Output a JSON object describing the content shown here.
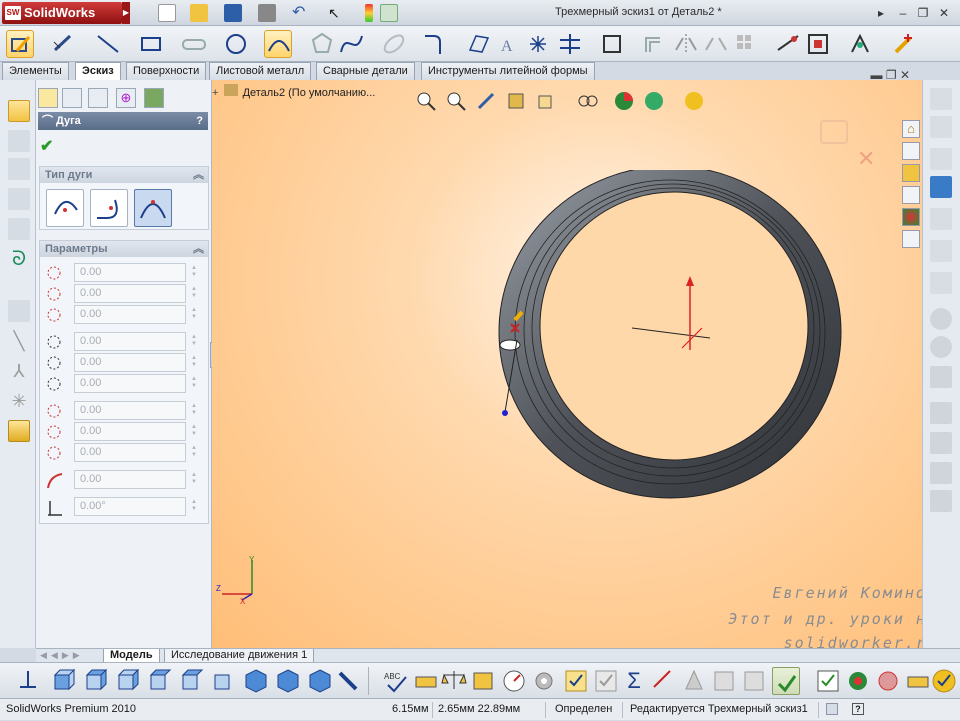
{
  "app": {
    "name": "SolidWorks",
    "window_title": "Трехмерный эскиз1 от Деталь2 *"
  },
  "command_tabs": [
    "Элементы",
    "Эскиз",
    "Поверхности",
    "Листовой металл",
    "Сварные детали",
    "Инструменты литейной формы"
  ],
  "active_tab": "Эскиз",
  "property_manager": {
    "title": "Дуга",
    "help": "?",
    "ok_symbol": "✔",
    "arc_type_group": "Тип дуги",
    "params_group": "Параметры",
    "params": [
      "0.00",
      "0.00",
      "0.00",
      "0.00",
      "0.00",
      "0.00",
      "0.00",
      "0.00",
      "0.00",
      "0.00",
      "0.00°"
    ]
  },
  "viewport": {
    "tree_label": "Деталь2  (По умолчанию...",
    "watermark": [
      "Евгений Коминов",
      "Этот и др. уроки на",
      "solidworker.ru"
    ]
  },
  "bottom_tabs": [
    "Модель",
    "Исследование движения 1"
  ],
  "status": {
    "product": "SolidWorks Premium 2010",
    "v1": "6.15мм",
    "v2": "2.65мм 22.89мм",
    "state": "Определен",
    "editing": "Редактируется Трехмерный эскиз1",
    "help": "?"
  },
  "colors": {
    "accent": "#5a6d88",
    "viewport_bg": "#ffbe78",
    "model": "#5a5d63",
    "highlight": "#ffd46a"
  }
}
